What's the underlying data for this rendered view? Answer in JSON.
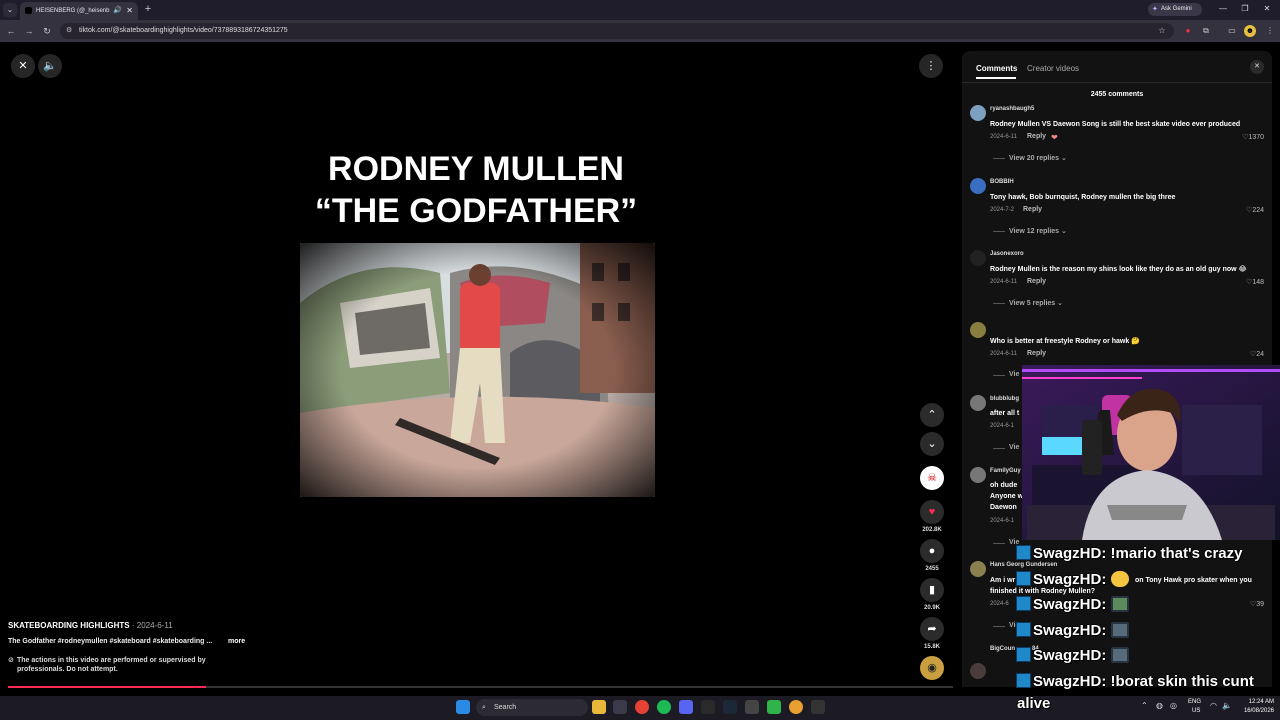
{
  "browser": {
    "tab_title": "HEISENBERG (@_heisenb",
    "ask_gemini": "Ask Gemini",
    "url": "tiktok.com/@skateboardinghighlights/video/7378893186724351275"
  },
  "video": {
    "headline_line1": "RODNEY MULLEN",
    "headline_line2": "“THE GODFATHER”",
    "channel": "SKATEBOARDING HIGHLIGHTS",
    "date": "· 2024-6-11",
    "caption": "The Godfather #rodneymullen #skateboard #skateboarding ...",
    "more": "more",
    "warning": "The actions in this video are performed or supervised by professionals. Do not attempt.",
    "progress_fraction": 0.21,
    "counts": {
      "likes": "202.8K",
      "comments": "2455",
      "saves": "20.9K",
      "shares": "15.8K"
    }
  },
  "comments_panel": {
    "tab_comments": "Comments",
    "tab_creator": "Creator videos",
    "total": "2455 comments",
    "reply_label": "Reply",
    "comments": [
      {
        "user": "ryanashbaugh5",
        "text": "Rodney Mullen VS Daewon Song is still the best skate video ever produced",
        "date": "2024-6-11",
        "likes": "1370",
        "view": "View 20 replies"
      },
      {
        "user": "BOBBIH",
        "text": "Tony hawk, Bob burnquist, Rodney mullen the big three",
        "date": "2024-7-2",
        "likes": "224",
        "view": "View 12 replies"
      },
      {
        "user": "Jasonexoro",
        "text": "Rodney Mullen is the reason my shins look like they do as an old guy now 😂",
        "date": "2024-6-11",
        "likes": "148",
        "view": "View 5 replies"
      },
      {
        "user": "",
        "text": "Who is better at freestyle Rodney or hawk 🤔",
        "date": "2024-6-11",
        "likes": "24",
        "view": "Vie"
      },
      {
        "user": "blubblubg",
        "text": "after all t",
        "date": "2024-6-1",
        "likes": "",
        "view": "Vie"
      },
      {
        "user": "FamilyGuy",
        "text": "oh dude",
        "text2": "Anyone w",
        "text3": "Daewon",
        "date": "2024-6-1",
        "likes": "",
        "view": "Vie"
      },
      {
        "user": "Hans Georg Gundersen",
        "text": "Am i wr",
        "text_end": "on Tony Hawk pro skater when you",
        "text2": "finished it with Rodney Mullen?",
        "date": "2024-6",
        "likes": "39",
        "view": "Vie"
      },
      {
        "user": "BigCoun",
        "user_end": "84"
      }
    ]
  },
  "stream_chat": [
    {
      "user": "SwagzHD:",
      "msg": "!mario that's crazy"
    },
    {
      "user": "SwagzHD:",
      "msg": ""
    },
    {
      "user": "SwagzHD:",
      "msg": ""
    },
    {
      "user": "SwagzHD:",
      "msg": ""
    },
    {
      "user": "SwagzHD:",
      "msg": ""
    },
    {
      "user": "SwagzHD:",
      "msg": "!borat skin this cunt"
    }
  ],
  "stream_alive": "alive",
  "taskbar": {
    "search": "Search",
    "lang1": "ENG",
    "lang2": "US",
    "time": "12:24 AM",
    "date": "16/08/2026"
  },
  "colors": {
    "accent": "#fe2c55",
    "panel": "#121212"
  }
}
